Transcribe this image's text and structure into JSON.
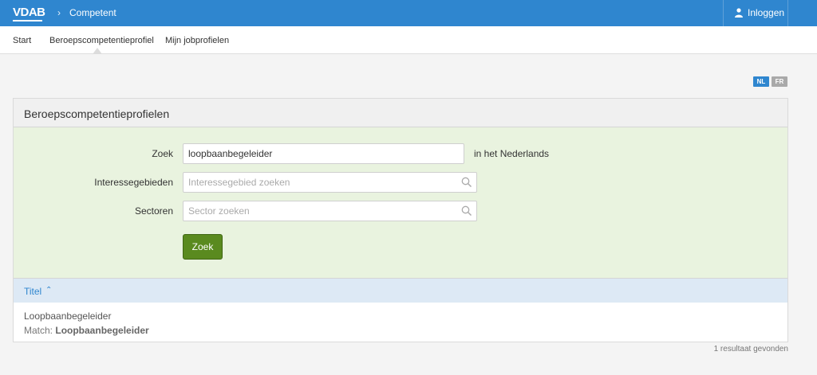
{
  "topbar": {
    "logo": "VDAB",
    "breadcrumb": "Competent",
    "login_label": "Inloggen"
  },
  "tabs": [
    {
      "label": "Start"
    },
    {
      "label": "Beroepscompetentieprofiel"
    },
    {
      "label": "Mijn jobprofielen"
    }
  ],
  "languages": [
    "NL",
    "FR"
  ],
  "panel": {
    "title": "Beroepscompetentieprofielen",
    "form": {
      "search_label": "Zoek",
      "search_value": "loopbaanbegeleider",
      "search_suffix": "in het Nederlands",
      "interest_label": "Interessegebieden",
      "interest_placeholder": "Interessegebied zoeken",
      "sector_label": "Sectoren",
      "sector_placeholder": "Sector zoeken",
      "submit_label": "Zoek"
    },
    "results": {
      "column_title": "Titel",
      "sort_icon": "chevron-up-icon",
      "items": [
        {
          "title": "Loopbaanbegeleider",
          "match_label": "Match:",
          "match_value": "Loopbaanbegeleider"
        }
      ],
      "count_text": "1 resultaat gevonden"
    }
  },
  "colors": {
    "brand_blue": "#2f86cf",
    "form_bg": "#e9f3df",
    "button_green": "#5a8a1f",
    "results_header_bg": "#dde9f5"
  }
}
